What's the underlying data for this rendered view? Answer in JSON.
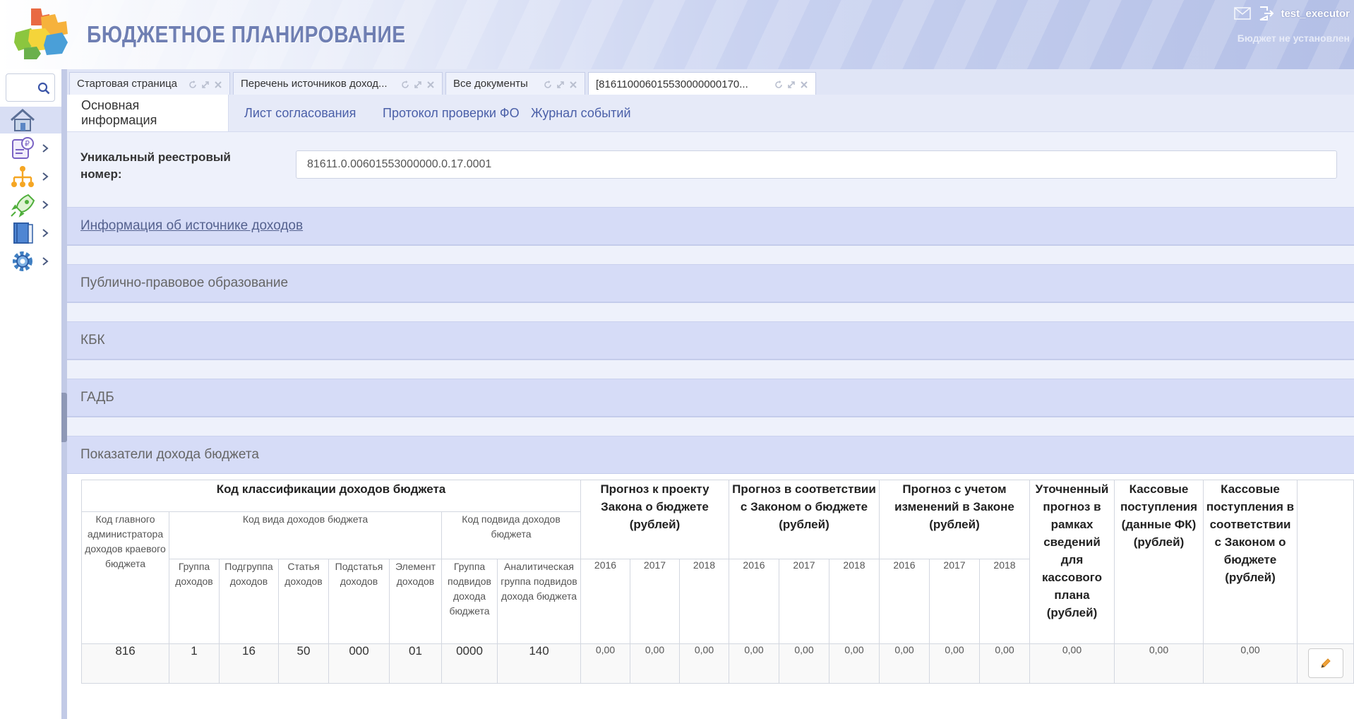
{
  "header": {
    "app_title": "БЮДЖЕТНОЕ ПЛАНИРОВАНИЕ",
    "username": "test_executor",
    "budget_status": "Бюджет не установлен"
  },
  "sidebar": {
    "search_placeholder": "",
    "items": [
      {
        "name": "home-icon"
      },
      {
        "name": "scroll-money-icon"
      },
      {
        "name": "hierarchy-icon"
      },
      {
        "name": "rocket-icon"
      },
      {
        "name": "book-icon"
      },
      {
        "name": "gear-icon"
      }
    ]
  },
  "doc_tabs": [
    {
      "label": "Стартовая страница"
    },
    {
      "label": "Перечень источников доход..."
    },
    {
      "label": "Все документы"
    },
    {
      "label": "[816110006015530000000170..."
    }
  ],
  "inner_tabs": [
    {
      "label": "Основная информация"
    },
    {
      "label": "Лист согласования"
    },
    {
      "label": "Протокол проверки ФО"
    },
    {
      "label": "Журнал событий"
    }
  ],
  "form": {
    "registry_label": "Уникальный реестровый номер:",
    "registry_value": "81611.0.00601553000000.0.17.0001"
  },
  "sections": [
    {
      "title": "Информация об источнике доходов"
    },
    {
      "title": "Публично-правовое образование"
    },
    {
      "title": "КБК"
    },
    {
      "title": "ГАДБ"
    },
    {
      "title": "Показатели дохода бюджета"
    }
  ],
  "table": {
    "h_kbk": "Код классификации доходов бюджета",
    "h_admin": "Код главного администратора доходов краевого бюджета",
    "h_vid": "Код вида доходов бюджета",
    "h_podvid": "Код подвида доходов бюджета",
    "h_group": "Группа доходов",
    "h_subgroup": "Подгруппа доходов",
    "h_article": "Статья доходов",
    "h_subarticle": "Подстатья доходов",
    "h_element": "Элемент доходов",
    "h_podvid_group": "Группа подвидов дохода бюджета",
    "h_analytic": "Аналитическая группа подвидов дохода бюджета",
    "h_forecast1": "Прогноз к проекту Закона о бюджете (рублей)",
    "h_forecast2": "Прогноз в соответствии с Законом о бюджете (рублей)",
    "h_forecast3": "Прогноз с учетом изменений в Законе (рублей)",
    "h_refined": "Уточненный прогноз в рамках сведений для кассового плана (рублей)",
    "h_cash_fk": "Кассовые поступления (данные ФК) (рублей)",
    "h_cash_law": "Кассовые поступления в соответствии с Законом о бюджете (рублей)",
    "years": [
      "2016",
      "2017",
      "2018"
    ],
    "row": {
      "admin": "816",
      "group": "1",
      "subgroup": "16",
      "article": "50",
      "subarticle": "000",
      "element": "01",
      "podvid_group": "0000",
      "analytic": "140",
      "f1": [
        "0,00",
        "0,00",
        "0,00"
      ],
      "f2": [
        "0,00",
        "0,00",
        "0,00"
      ],
      "f3": [
        "0,00",
        "0,00",
        "0,00"
      ],
      "refined": "0,00",
      "cash_fk": "0,00",
      "cash_law": "0,00"
    }
  }
}
